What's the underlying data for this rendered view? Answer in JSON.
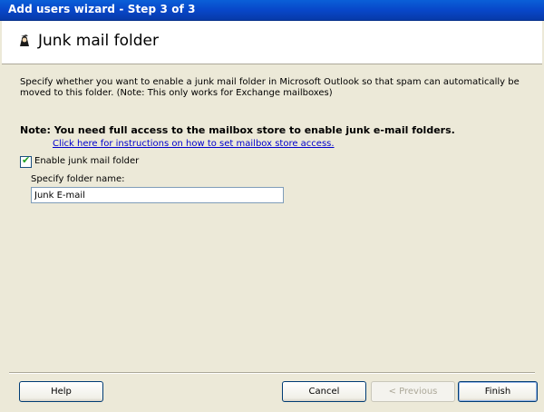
{
  "window": {
    "title": "Add users wizard - Step 3 of 3"
  },
  "header": {
    "title": "Junk mail folder",
    "icon": "wizard-icon"
  },
  "content": {
    "description": "Specify whether you want to enable a junk mail folder in Microsoft Outlook so that spam can automatically be moved to this folder. (Note: This only works for Exchange mailboxes)",
    "note": "Note: You need full access to the mailbox store to enable junk e-mail folders.",
    "link": "Click here for instructions on how to set mailbox store access.",
    "enable_checkbox": {
      "label": "Enable junk mail folder",
      "checked": true
    },
    "folder_name": {
      "label": "Specify folder name:",
      "value": "Junk E-mail"
    }
  },
  "buttons": {
    "help": "Help",
    "cancel": "Cancel",
    "previous": "< Previous",
    "finish": "Finish"
  },
  "colors": {
    "titlebar": "#0a5fd8",
    "dialog_bg": "#ece9d8",
    "link": "#0000cc",
    "check": "#21a121"
  }
}
